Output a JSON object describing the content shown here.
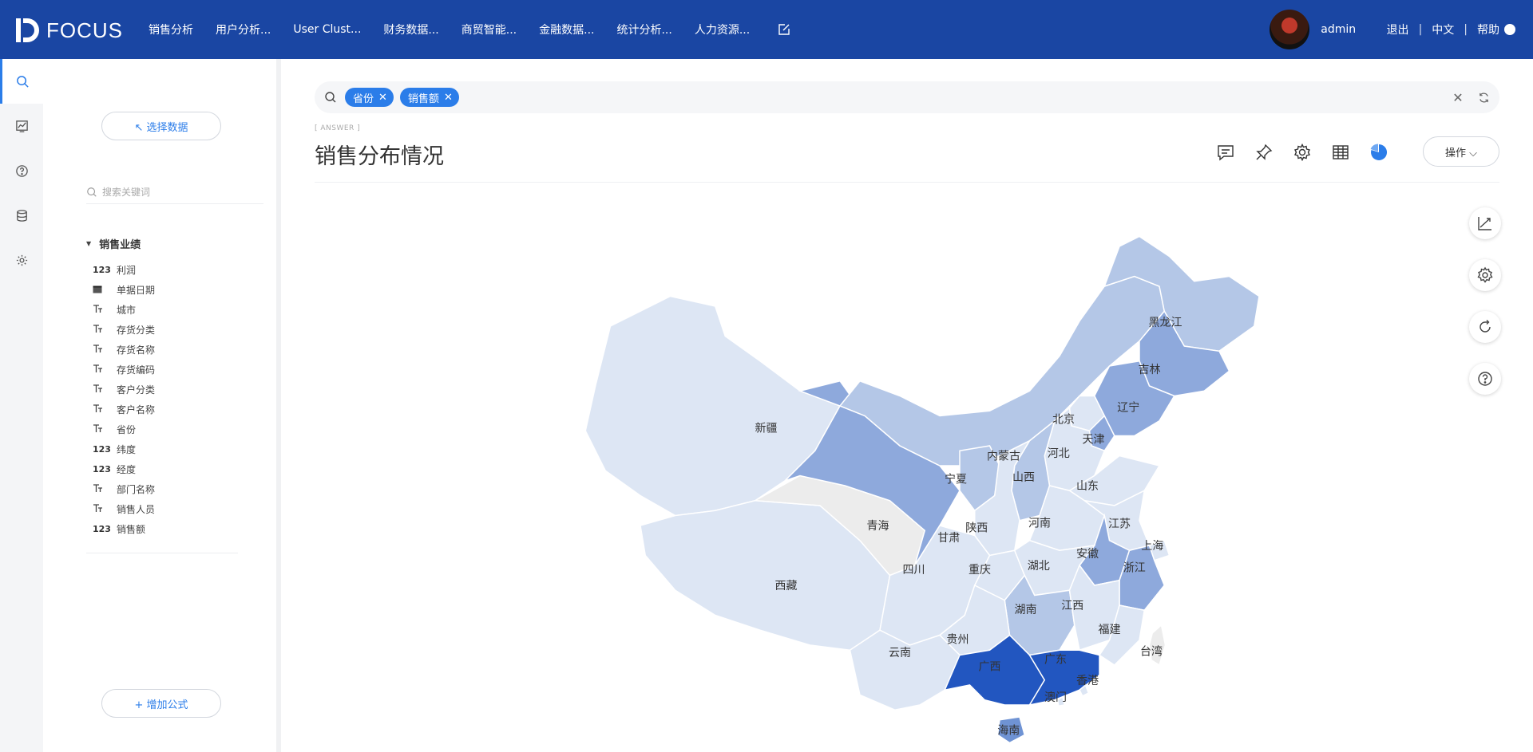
{
  "brand": {
    "name": "FOCUS"
  },
  "nav": {
    "items": [
      "销售分析",
      "用户分析...",
      "User Clust...",
      "财务数据...",
      "商贸智能...",
      "金融数据...",
      "统计分析...",
      "人力资源..."
    ]
  },
  "user": {
    "name": "admin",
    "logout": "退出",
    "lang": "中文",
    "help": "帮助",
    "help_icon": "?"
  },
  "panel": {
    "select_data": "↖ 选择数据",
    "search_placeholder": "搜索关键词",
    "group": "销售业绩",
    "fields": [
      {
        "type": "123",
        "name": "利润"
      },
      {
        "type": "date",
        "name": "单据日期"
      },
      {
        "type": "text",
        "name": "城市"
      },
      {
        "type": "text",
        "name": "存货分类"
      },
      {
        "type": "text",
        "name": "存货名称"
      },
      {
        "type": "text",
        "name": "存货编码"
      },
      {
        "type": "text",
        "name": "客户分类"
      },
      {
        "type": "text",
        "name": "客户名称"
      },
      {
        "type": "text",
        "name": "省份"
      },
      {
        "type": "123",
        "name": "纬度"
      },
      {
        "type": "123",
        "name": "经度"
      },
      {
        "type": "text",
        "name": "部门名称"
      },
      {
        "type": "text",
        "name": "销售人员"
      },
      {
        "type": "123",
        "name": "销售额"
      }
    ],
    "add_formula": "+ 增加公式"
  },
  "search": {
    "tags": [
      "省份",
      "销售额"
    ]
  },
  "answer": {
    "label": "[ ANSWER ]",
    "title": "销售分布情况",
    "ops": "操作 ⌵"
  },
  "colors": {
    "brand": "#1a46a3",
    "accent": "#2b7de9",
    "map_levels": [
      "#ececec",
      "#dde6f4",
      "#b4c7e7",
      "#8ea9dc",
      "#6f93d4",
      "#2256c0"
    ]
  },
  "map": {
    "provinces": [
      {
        "name": "新疆",
        "level": 1
      },
      {
        "name": "西藏",
        "level": 1
      },
      {
        "name": "青海",
        "level": 0
      },
      {
        "name": "甘肃",
        "level": 3
      },
      {
        "name": "内蒙古",
        "level": 2
      },
      {
        "name": "黑龙江",
        "level": 2
      },
      {
        "name": "吉林",
        "level": 3
      },
      {
        "name": "辽宁",
        "level": 3
      },
      {
        "name": "北京",
        "level": 1
      },
      {
        "name": "天津",
        "level": 3
      },
      {
        "name": "河北",
        "level": 1
      },
      {
        "name": "山西",
        "level": 2
      },
      {
        "name": "宁夏",
        "level": 2
      },
      {
        "name": "陕西",
        "level": 1
      },
      {
        "name": "山东",
        "level": 1
      },
      {
        "name": "河南",
        "level": 1
      },
      {
        "name": "江苏",
        "level": 1
      },
      {
        "name": "上海",
        "level": 1
      },
      {
        "name": "安徽",
        "level": 3
      },
      {
        "name": "浙江",
        "level": 3
      },
      {
        "name": "四川",
        "level": 1
      },
      {
        "name": "重庆",
        "level": 1
      },
      {
        "name": "湖北",
        "level": 1
      },
      {
        "name": "湖南",
        "level": 2
      },
      {
        "name": "江西",
        "level": 1
      },
      {
        "name": "福建",
        "level": 1
      },
      {
        "name": "贵州",
        "level": 1
      },
      {
        "name": "云南",
        "level": 1
      },
      {
        "name": "广西",
        "level": 5
      },
      {
        "name": "广东",
        "level": 5
      },
      {
        "name": "香港",
        "level": 1
      },
      {
        "name": "澳门",
        "level": 1
      },
      {
        "name": "海南",
        "level": 4
      },
      {
        "name": "台湾",
        "level": 0
      }
    ]
  }
}
